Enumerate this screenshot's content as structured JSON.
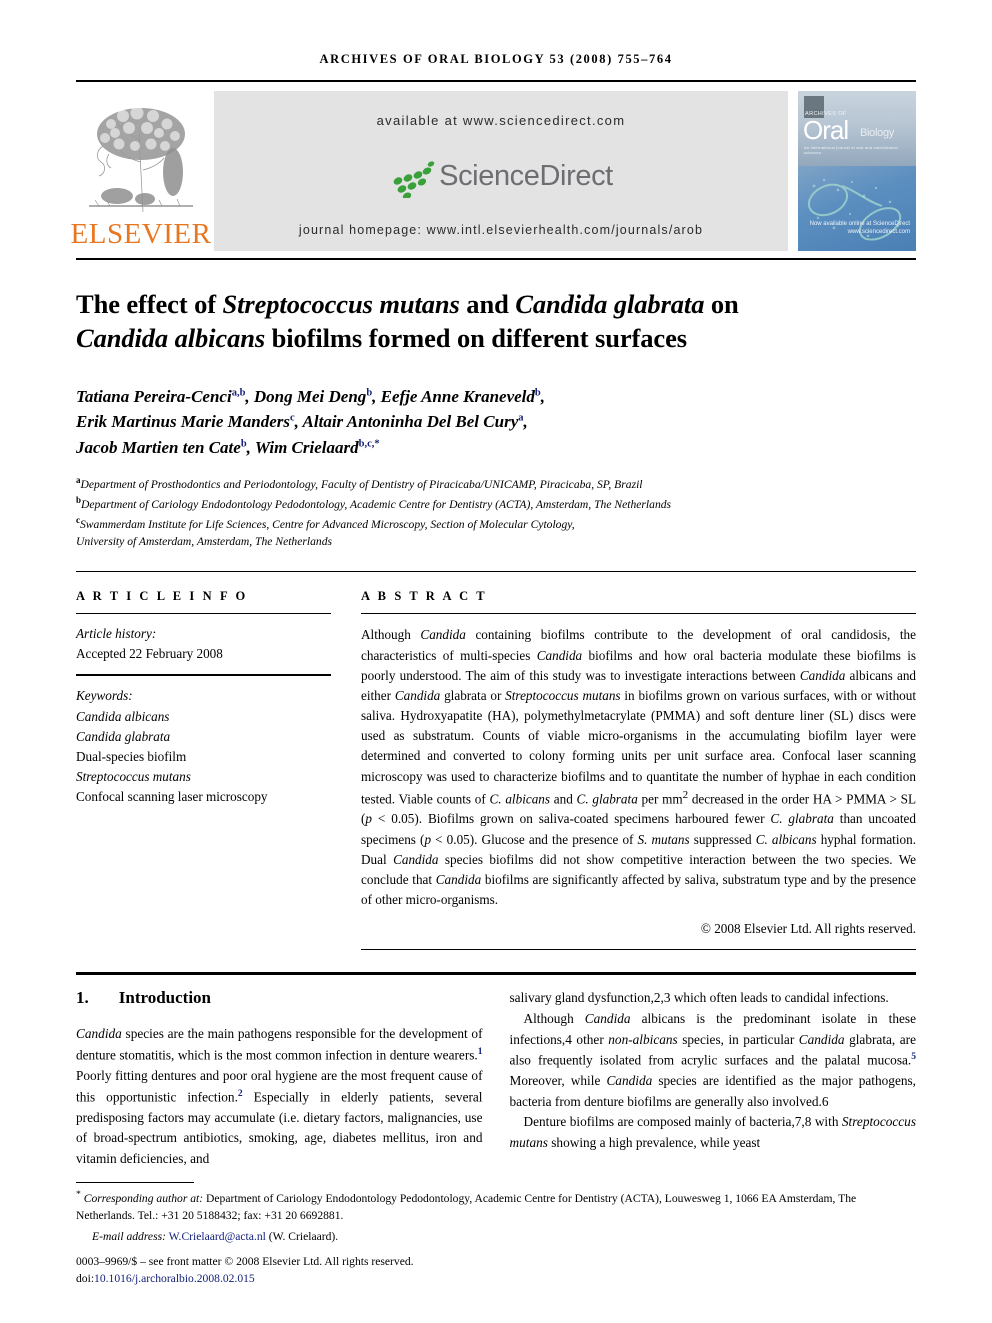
{
  "running_head": "ARCHIVES OF ORAL BIOLOGY 53 (2008) 755–764",
  "masthead": {
    "publisher_name": "ELSEVIER",
    "available_at": "available at www.sciencedirect.com",
    "sciencedirect_wordmark": "ScienceDirect",
    "journal_homepage": "journal homepage: www.intl.elsevierhealth.com/journals/arob",
    "cover": {
      "archives_line": "ARCHIVES OF",
      "oral": "Oral",
      "biology": "Biology",
      "tagline": "An international journal of oral and maxillofacial sciences",
      "sciencedirect_badge": "Now available online at\nScienceDirect\nwww.sciencedirect.com"
    }
  },
  "article": {
    "title_line1_a": "The effect of ",
    "title_line1_i1": "Streptococcus mutans",
    "title_line1_b": " and ",
    "title_line1_i2": "Candida glabrata",
    "title_line1_c": " on",
    "title_line2_i": "Candida albicans",
    "title_line2_rest": " biofilms formed on different surfaces",
    "authors": [
      {
        "name": "Tatiana Pereira-Cenci",
        "sup": "a,b",
        "sep": ", "
      },
      {
        "name": "Dong Mei Deng",
        "sup": "b",
        "sep": ", "
      },
      {
        "name": "Eefje Anne Kraneveld",
        "sup": "b",
        "sep": ",",
        "break_after": true
      },
      {
        "name": "Erik Martinus Marie Manders",
        "sup": "c",
        "sep": ", "
      },
      {
        "name": "Altair Antoninha Del Bel Cury",
        "sup": "a",
        "sep": ",",
        "break_after": true
      },
      {
        "name": "Jacob Martien ten Cate",
        "sup": "b",
        "sep": ", "
      },
      {
        "name": "Wim Crielaard",
        "sup": "b,c,*",
        "sep": ""
      }
    ],
    "affiliations": [
      {
        "marker": "a",
        "text": "Department of Prosthodontics and Periodontology, Faculty of Dentistry of Piracicaba/UNICAMP, Piracicaba, SP, Brazil"
      },
      {
        "marker": "b",
        "text": "Department of Cariology Endodontology Pedodontology, Academic Centre for Dentistry (ACTA), Amsterdam, The Netherlands"
      },
      {
        "marker": "c",
        "text": "Swammerdam Institute for Life Sciences, Centre for Advanced Microscopy, Section of Molecular Cytology,"
      },
      {
        "marker": "",
        "text": "University of Amsterdam, Amsterdam, The Netherlands"
      }
    ]
  },
  "article_info": {
    "heading": "A R T I C L E  I N F O",
    "history_label": "Article history:",
    "history_value": "Accepted 22 February 2008",
    "keywords_label": "Keywords:",
    "keywords": [
      {
        "text": "Candida albicans",
        "italic": true
      },
      {
        "text": "Candida glabrata",
        "italic": true
      },
      {
        "text": "Dual-species biofilm",
        "italic": false
      },
      {
        "text": "Streptococcus mutans",
        "italic": true
      },
      {
        "text": "Confocal scanning laser microscopy",
        "italic": false
      }
    ]
  },
  "abstract": {
    "heading": "A B S T R A C T",
    "paragraph": "Although Candida containing biofilms contribute to the development of oral candidosis, the characteristics of multi-species Candida biofilms and how oral bacteria modulate these biofilms is poorly understood. The aim of this study was to investigate interactions between Candida albicans and either Candida glabrata or Streptococcus mutans in biofilms grown on various surfaces, with or without saliva. Hydroxyapatite (HA), polymethylmetacrylate (PMMA) and soft denture liner (SL) discs were used as substratum. Counts of viable micro-organisms in the accumulating biofilm layer were determined and converted to colony forming units per unit surface area. Confocal laser scanning microscopy was used to characterize biofilms and to quantitate the number of hyphae in each condition tested. Viable counts of C. albicans and C. glabrata per mm2 decreased in the order HA > PMMA > SL (p < 0.05). Biofilms grown on saliva-coated specimens harboured fewer C. glabrata than uncoated specimens (p < 0.05). Glucose and the presence of S. mutans suppressed C. albicans hyphal formation. Dual Candida species biofilms did not show competitive interaction between the two species. We conclude that Candida biofilms are significantly affected by saliva, substratum type and by the presence of other micro-organisms.",
    "copyright": "© 2008 Elsevier Ltd. All rights reserved."
  },
  "introduction": {
    "number": "1.",
    "heading": "Introduction",
    "left_paragraph_1": "Candida species are the main pathogens responsible for the development of denture stomatitis, which is the most common infection in denture wearers.1 Poorly fitting dentures and poor oral hygiene are the most frequent cause of this opportunistic infection.2 Especially in elderly patients, several predisposing factors may accumulate (i.e. dietary factors, malignancies, use of broad-spectrum antibiotics, smoking, age, diabetes mellitus, iron and vitamin deficiencies, and",
    "right_paragraph_1": "salivary gland dysfunction,2,3 which often leads to candidal infections.",
    "right_paragraph_2": "Although Candida albicans is the predominant isolate in these infections,4 other non-albicans species, in particular Candida glabrata, are also frequently isolated from acrylic surfaces and the palatal mucosa.5 Moreover, while Candida species are identified as the major pathogens, bacteria from denture biofilms are generally also involved.6",
    "right_paragraph_3": "Denture biofilms are composed mainly of bacteria,7,8 with Streptococcus mutans showing a high prevalence, while yeast"
  },
  "footnote": {
    "corresponding_label": "Corresponding author at:",
    "corresponding_text": " Department of Cariology Endodontology Pedodontology, Academic Centre for Dentistry (ACTA), Louwesweg 1, 1066 EA Amsterdam, The Netherlands. Tel.: +31 20 5188432; fax: +31 20 6692881.",
    "email_label": "E-mail address:",
    "email_address": "W.Crielaard@acta.nl",
    "email_owner": "(W. Crielaard).",
    "issn_line": "0003–9969/$ – see front matter © 2008 Elsevier Ltd. All rights reserved.",
    "doi_prefix": "doi:",
    "doi_value": "10.1016/j.archoralbio.2008.02.015"
  },
  "colors": {
    "elsevier_orange": "#E87722",
    "link_navy": "#14217a",
    "sciencedirect_green": "#3aa03a",
    "sciencedirect_grey": "#6d6e71",
    "banner_grey": "#e3e3e3"
  }
}
